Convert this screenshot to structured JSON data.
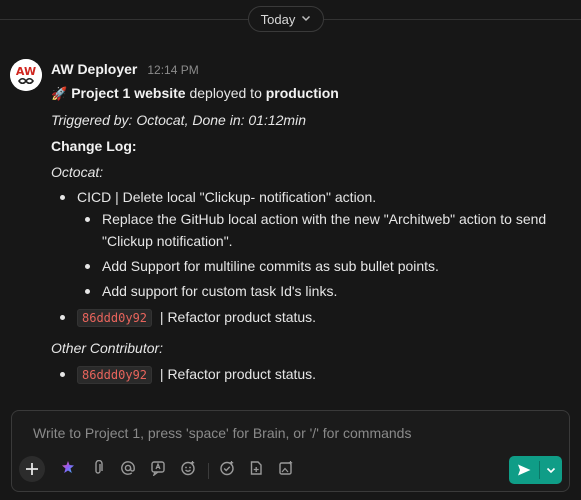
{
  "divider": {
    "label": "Today"
  },
  "message": {
    "sender": "AW Deployer",
    "time": "12:14 PM",
    "avatar_text": "AW",
    "headline": {
      "project": "Project 1 website",
      "mid": " deployed to ",
      "env": "production"
    },
    "triggered": "Triggered by: Octocat, Done in: 01:12min",
    "changelog_title": "Change Log:",
    "sections": [
      {
        "author": "Octocat:",
        "items": [
          {
            "text": "CICD | Delete local \"Clickup- notification\" action.",
            "subitems": [
              "Replace the GitHub local action with the new \"Architweb\" action to send \"Clickup notification\".",
              "Add Support for multiline commits as sub bullet points.",
              "Add support for custom task Id's links."
            ]
          },
          {
            "commit": "86ddd0y92",
            "text": " | Refactor product status."
          }
        ]
      },
      {
        "author": "Other Contributor:",
        "items": [
          {
            "commit": "86ddd0y92",
            "text": " | Refactor product status."
          }
        ]
      }
    ]
  },
  "composer": {
    "placeholder": "Write to Project 1, press 'space' for Brain, or '/' for commands",
    "tools": [
      "plus-icon",
      "brain-icon",
      "attach-icon",
      "mention-icon",
      "ai-icon",
      "emoji-icon",
      "task-icon",
      "doc-icon",
      "image-icon"
    ],
    "send_color": "#0f9d87"
  }
}
